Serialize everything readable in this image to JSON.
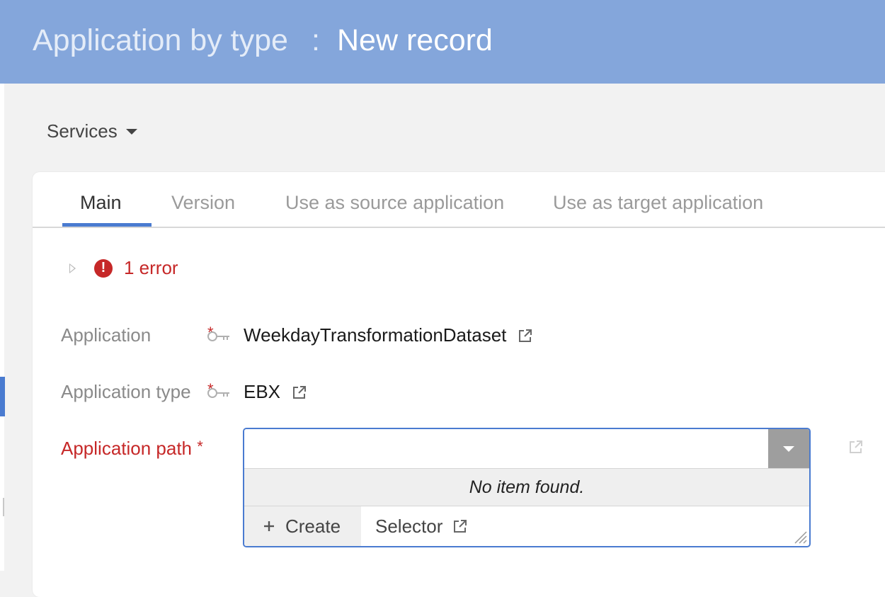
{
  "header": {
    "crumb": "Application by type",
    "separator": ":",
    "title": "New record"
  },
  "toolbar": {
    "services_label": "Services"
  },
  "tabs": [
    {
      "label": "Main",
      "active": true
    },
    {
      "label": "Version",
      "active": false
    },
    {
      "label": "Use as source application",
      "active": false
    },
    {
      "label": "Use as target application",
      "active": false
    }
  ],
  "errors": {
    "summary": "1 error"
  },
  "fields": {
    "application": {
      "label": "Application",
      "required_mark": "*",
      "value": "WeekdayTransformationDataset"
    },
    "application_type": {
      "label": "Application type",
      "required_mark": "*",
      "value": "EBX"
    },
    "application_path": {
      "label": "Application path",
      "required_mark": "*",
      "value": "",
      "empty_message": "No item found.",
      "create_label": "Create",
      "selector_label": "Selector"
    }
  },
  "colors": {
    "header_bg": "#84a6db",
    "accent": "#4a7bd0",
    "error": "#c62828"
  }
}
